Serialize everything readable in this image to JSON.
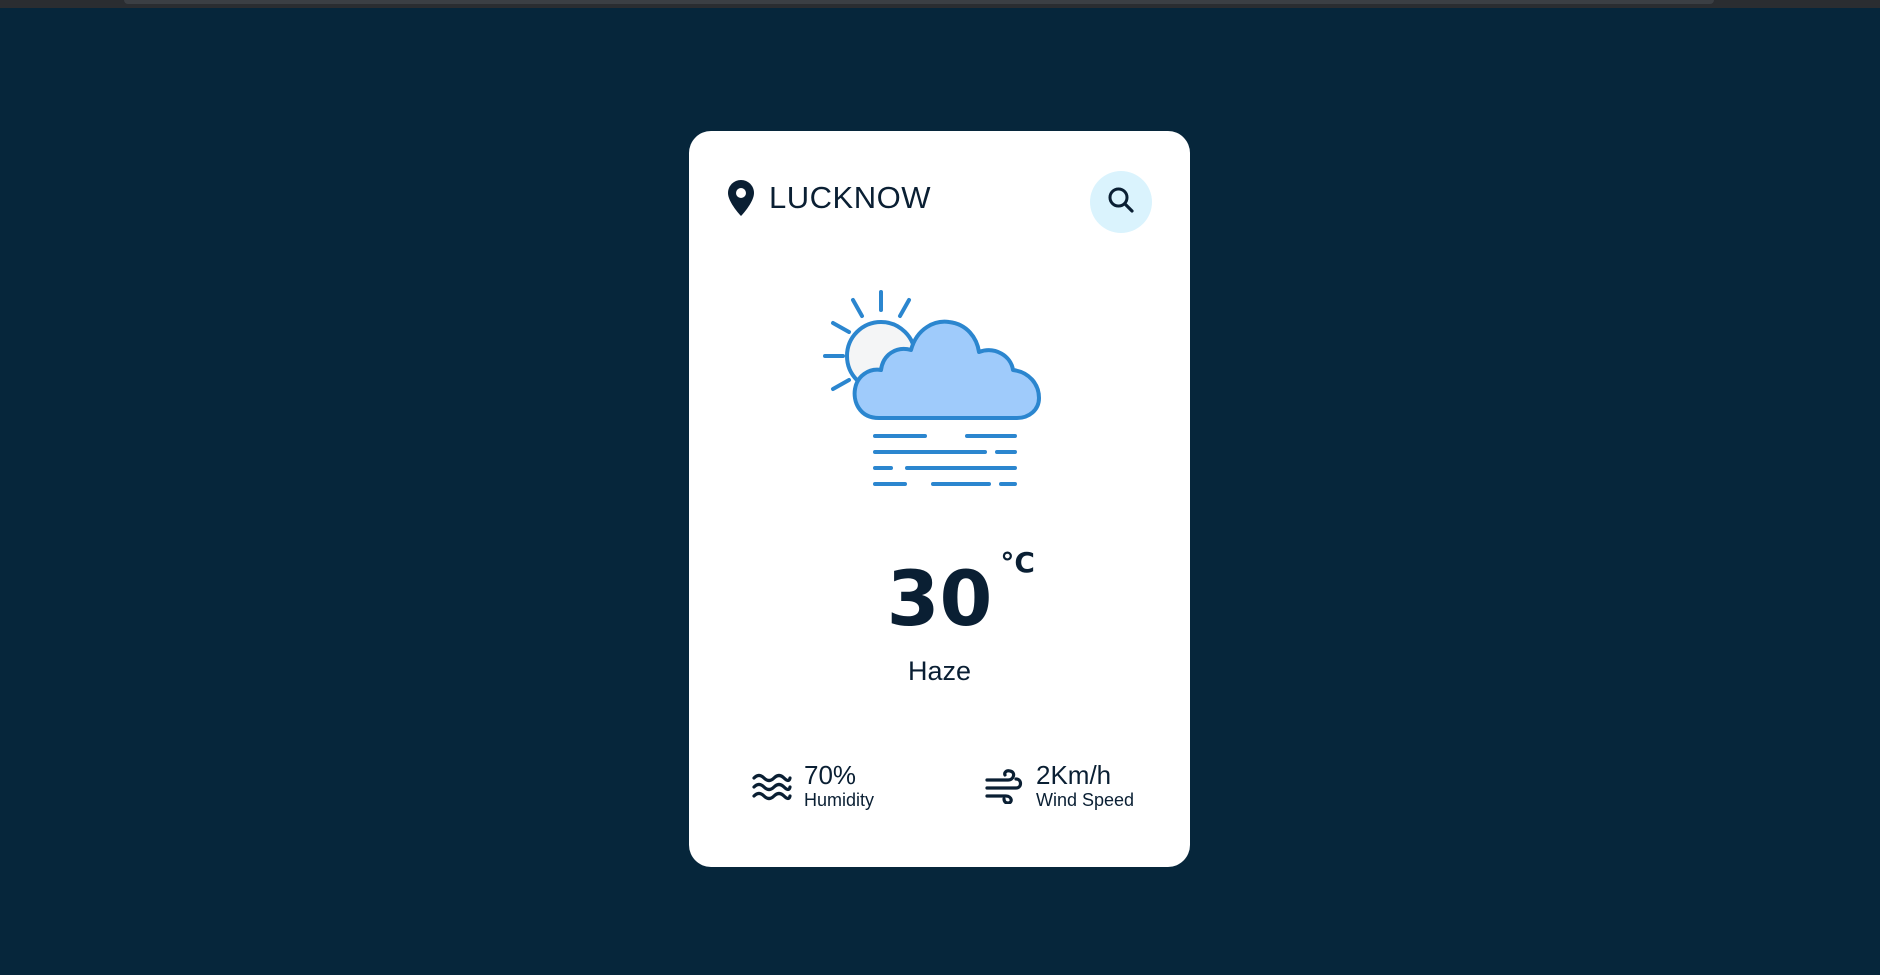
{
  "location": {
    "city": "LUCKNOW",
    "pin_icon": "location-pin-icon"
  },
  "search": {
    "icon": "search-icon"
  },
  "weather": {
    "icon": "haze-cloud-sun-icon",
    "temperature": "30",
    "unit": "°C",
    "condition": "Haze"
  },
  "stats": {
    "humidity": {
      "icon": "humidity-waves-icon",
      "value": "70%",
      "label": "Humidity"
    },
    "wind": {
      "icon": "wind-icon",
      "value": "2Km/h",
      "label": "Wind Speed"
    }
  },
  "colors": {
    "page_background": "#06263b",
    "card_background": "#ffffff",
    "text_dark": "#0a1f33",
    "search_button_bg": "#daf3fd",
    "icon_blue": "#2b86cf",
    "cloud_fill": "#9fcbfb"
  }
}
